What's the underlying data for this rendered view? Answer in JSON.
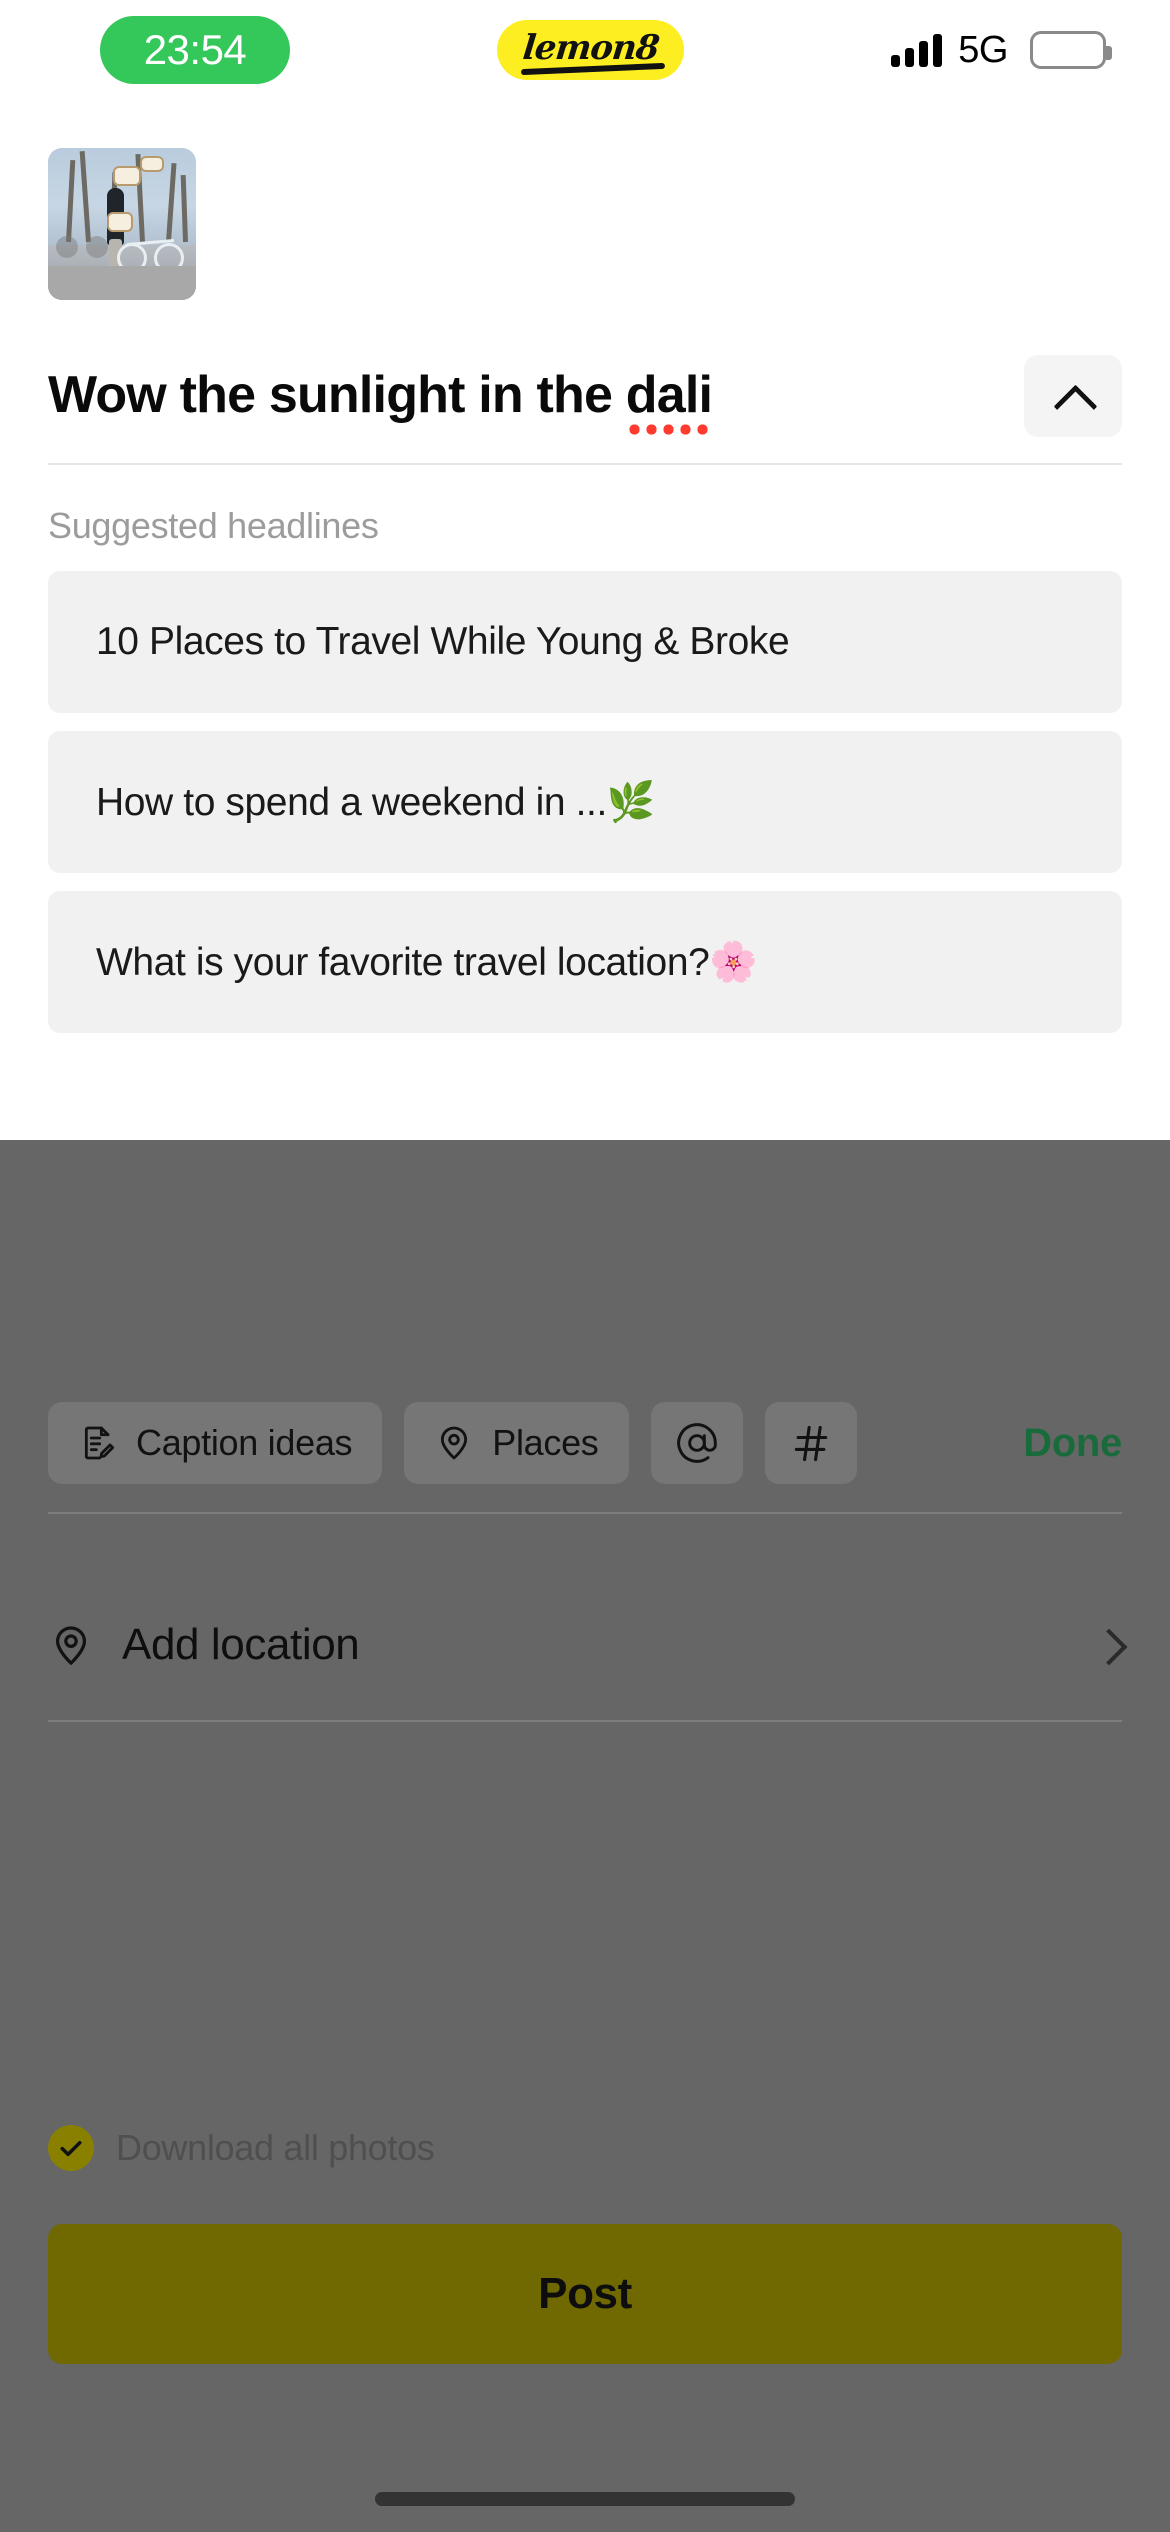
{
  "status_bar": {
    "time": "23:54",
    "app_logo": "lemon8",
    "network": "5G",
    "signal_icon": "signal-bars-icon",
    "battery_icon": "battery-full-icon",
    "time_pill_color": "#34c759",
    "logo_pill_color": "#fdee21"
  },
  "editor": {
    "thumbnail_alt": "post-photo-thumbnail",
    "title": {
      "prefix": "Wow the sunlight in the ",
      "misspelled_word": "dali",
      "full": "Wow the sunlight in the dali",
      "spellcheck_color": "#ff3b30"
    },
    "collapse_icon": "chevron-up-icon"
  },
  "suggestions": {
    "label": "Suggested headlines",
    "items": [
      {
        "text": "10 Places to Travel While Young & Broke"
      },
      {
        "text": "How to spend a weekend in ...🌿"
      },
      {
        "text": "What is your favorite travel location?🌸"
      }
    ]
  },
  "toolbar": {
    "caption_ideas": {
      "label": "Caption ideas",
      "icon": "document-edit-icon"
    },
    "places": {
      "label": "Places",
      "icon": "map-pin-icon"
    },
    "mention": {
      "label": "@",
      "icon": "at-sign-icon"
    },
    "hashtag": {
      "label": "#",
      "icon": "hashtag-icon"
    },
    "done": {
      "label": "Done",
      "color": "#1a6b3c"
    }
  },
  "location": {
    "label": "Add location",
    "icon": "map-pin-icon",
    "chevron_icon": "chevron-right-icon"
  },
  "download": {
    "label": "Download all photos",
    "checked": true,
    "check_icon": "check-icon",
    "check_color": "#8a8000"
  },
  "post_button": {
    "label": "Post",
    "color": "#706800"
  },
  "system": {
    "home_indicator": "home-indicator"
  }
}
